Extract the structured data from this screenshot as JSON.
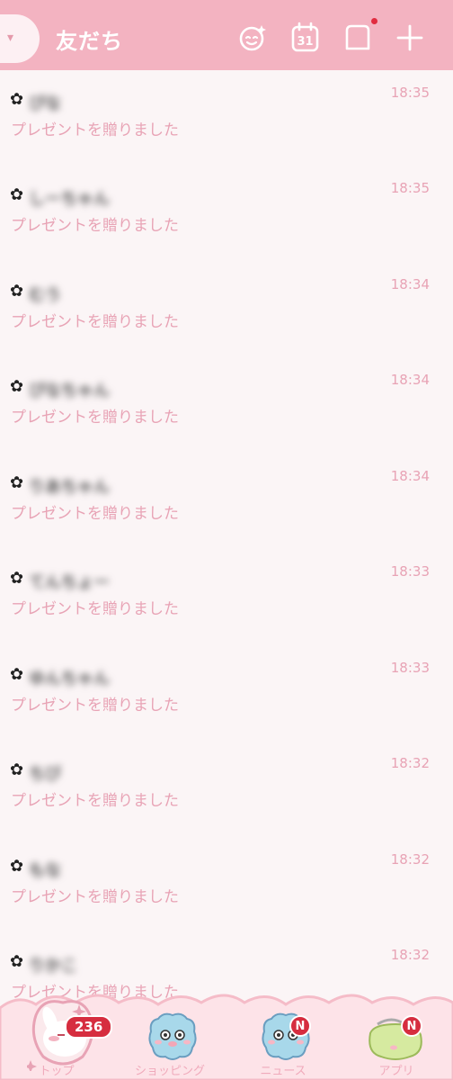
{
  "header": {
    "title": "友だち",
    "profile_chevron": "▾",
    "calendar_day": "31",
    "accent_color": "#f3b3c1",
    "icons": [
      "face-sparkle-icon",
      "calendar-icon",
      "note-icon",
      "add-icon"
    ]
  },
  "messages": [
    {
      "name": "ぴな",
      "text": "プレゼントを贈りました",
      "time": "18:35"
    },
    {
      "name": "しーちゃん",
      "text": "プレゼントを贈りました",
      "time": "18:35"
    },
    {
      "name": "むう",
      "text": "プレゼントを贈りました",
      "time": "18:34"
    },
    {
      "name": "ぴなちゃん",
      "text": "プレゼントを贈りました",
      "time": "18:34"
    },
    {
      "name": "りあちゃん",
      "text": "プレゼントを贈りました",
      "time": "18:34"
    },
    {
      "name": "てんちょー",
      "text": "プレゼントを贈りました",
      "time": "18:33"
    },
    {
      "name": "ゆんちゃん",
      "text": "プレゼントを贈りました",
      "time": "18:33"
    },
    {
      "name": "ちび",
      "text": "プレゼントを贈りました",
      "time": "18:32"
    },
    {
      "name": "もな",
      "text": "プレゼントを贈りました",
      "time": "18:32"
    },
    {
      "name": "りかこ",
      "text": "プレゼントを贈りました",
      "time": "18:32"
    }
  ],
  "bottom_nav": {
    "items": [
      {
        "label": "トップ",
        "badge": "236"
      },
      {
        "label": "ショッピング",
        "badge": ""
      },
      {
        "label": "ニュース",
        "badge": "N"
      },
      {
        "label": "アプリ",
        "badge": "N"
      }
    ]
  }
}
